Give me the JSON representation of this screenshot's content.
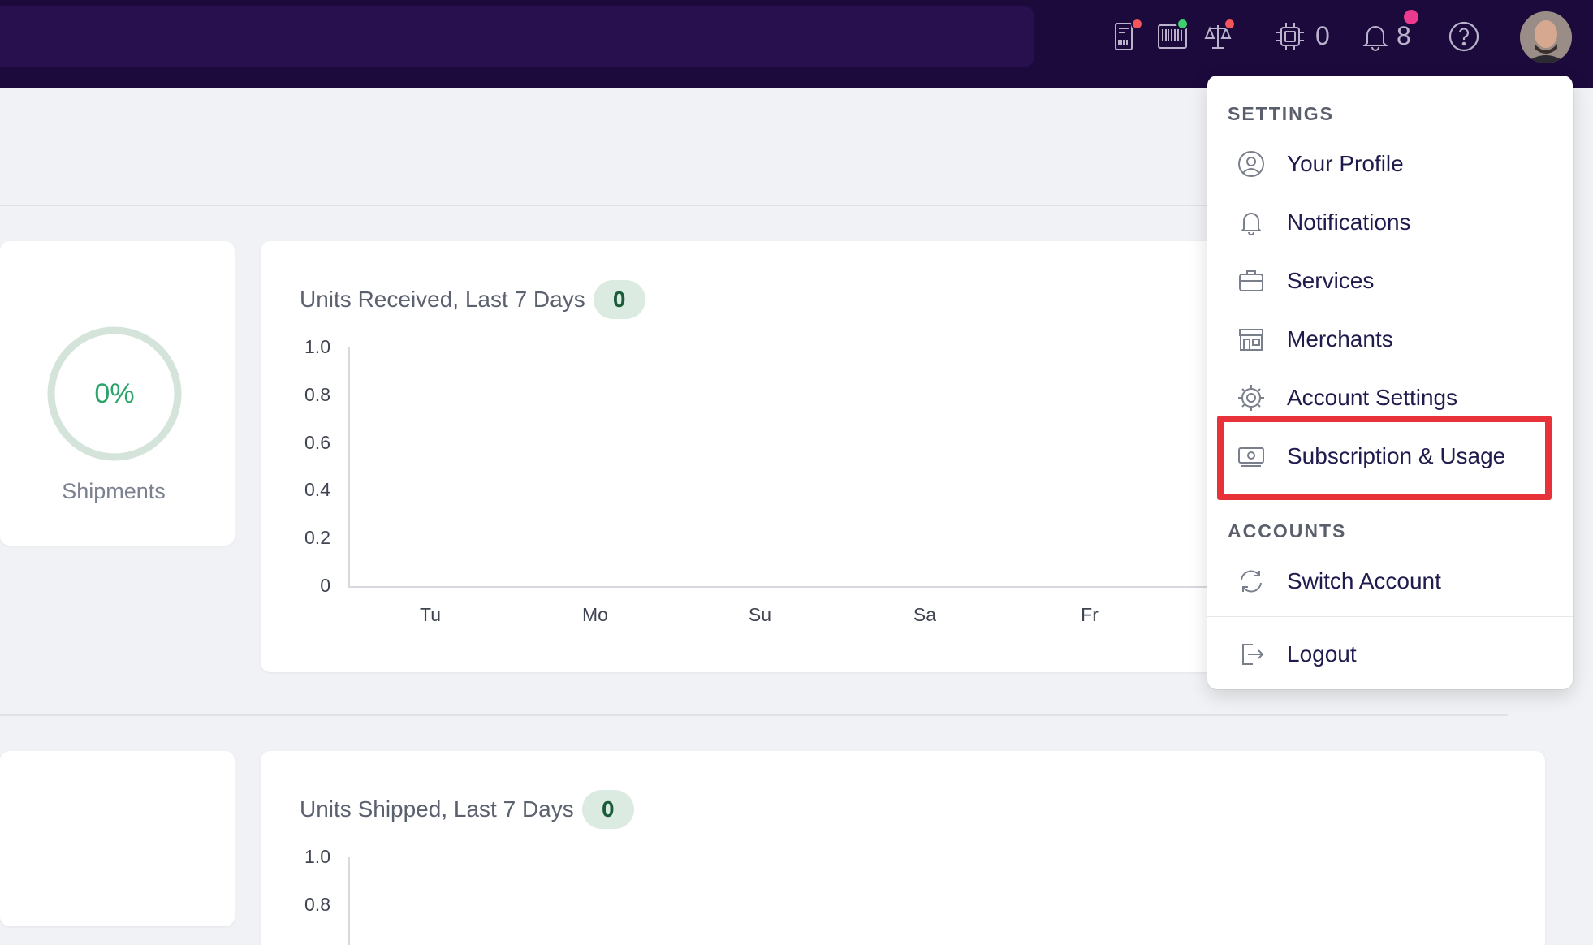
{
  "topbar": {
    "notifications_count": "8",
    "tasks_count": "0",
    "dot_colors": {
      "red": "#f2555a",
      "green": "#3ecf6e",
      "pink": "#ec3b8e"
    }
  },
  "dashboard": {
    "shipments": {
      "percent": "0%",
      "label": "Shipments"
    },
    "received_chart": {
      "title": "Units Received, Last 7 Days",
      "badge": "0"
    },
    "shipped_chart": {
      "title": "Units Shipped, Last 7 Days",
      "badge": "0"
    }
  },
  "chart_data": [
    {
      "type": "line",
      "title": "Units Received, Last 7 Days",
      "categories": [
        "Tu",
        "Mo",
        "Su",
        "Sa",
        "Fr"
      ],
      "y_ticks": [
        "1.0",
        "0.8",
        "0.6",
        "0.4",
        "0.2",
        "0"
      ],
      "ylim": [
        0,
        1
      ],
      "values": [],
      "grid": false
    },
    {
      "type": "line",
      "title": "Units Shipped, Last 7 Days",
      "y_ticks": [
        "1.0",
        "0.8"
      ],
      "ylim": [
        0,
        1
      ],
      "values": [],
      "grid": false
    }
  ],
  "menu": {
    "settings_heading": "SETTINGS",
    "accounts_heading": "ACCOUNTS",
    "items": [
      {
        "label": "Your Profile",
        "icon": "user-circle-icon"
      },
      {
        "label": "Notifications",
        "icon": "bell-icon"
      },
      {
        "label": "Services",
        "icon": "briefcase-icon"
      },
      {
        "label": "Merchants",
        "icon": "storefront-icon"
      },
      {
        "label": "Account Settings",
        "icon": "gear-icon"
      },
      {
        "label": "Subscription & Usage",
        "icon": "cash-icon"
      }
    ],
    "switch_account": "Switch Account",
    "logout": "Logout",
    "highlight_color": "#e8323a"
  }
}
